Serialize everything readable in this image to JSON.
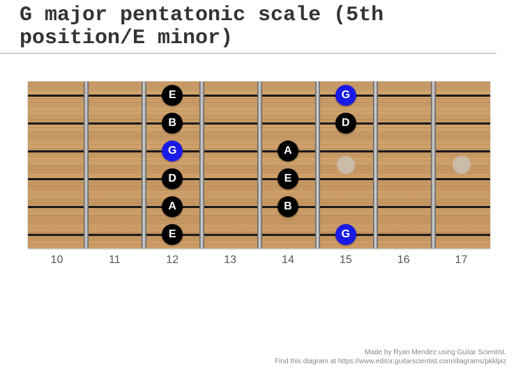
{
  "title": "G major pentatonic scale (5th position/E minor)",
  "credit": {
    "line1": "Made by Ryan Mendez using Guitar Scientist.",
    "line2": "Find this diagram at https://www.editor.guitarscientist.com/diagrams/pkklpiz"
  },
  "fretboard": {
    "strings": 6,
    "fret_start": 10,
    "fret_end": 17,
    "fret_markers_single": [
      15,
      17
    ],
    "fret_markers_double": [],
    "labeled_frets": [
      10,
      11,
      12,
      13,
      14,
      15,
      16,
      17
    ]
  },
  "notes": [
    {
      "string": 1,
      "fret": 12,
      "label": "E",
      "root": false
    },
    {
      "string": 1,
      "fret": 15,
      "label": "G",
      "root": true
    },
    {
      "string": 2,
      "fret": 12,
      "label": "B",
      "root": false
    },
    {
      "string": 2,
      "fret": 15,
      "label": "D",
      "root": false
    },
    {
      "string": 3,
      "fret": 12,
      "label": "G",
      "root": true
    },
    {
      "string": 3,
      "fret": 14,
      "label": "A",
      "root": false
    },
    {
      "string": 4,
      "fret": 12,
      "label": "D",
      "root": false
    },
    {
      "string": 4,
      "fret": 14,
      "label": "E",
      "root": false
    },
    {
      "string": 5,
      "fret": 12,
      "label": "A",
      "root": false
    },
    {
      "string": 5,
      "fret": 14,
      "label": "B",
      "root": false
    },
    {
      "string": 6,
      "fret": 12,
      "label": "E",
      "root": false
    },
    {
      "string": 6,
      "fret": 15,
      "label": "G",
      "root": true
    }
  ],
  "chart_data": {
    "type": "diagram",
    "title": "G major pentatonic scale (5th position/E minor)",
    "strings": 6,
    "fret_range": [
      10,
      17
    ],
    "root_note": "G",
    "scale_notes": [
      "G",
      "A",
      "B",
      "D",
      "E"
    ],
    "positions": [
      {
        "string": 1,
        "fret": 12,
        "note": "E"
      },
      {
        "string": 1,
        "fret": 15,
        "note": "G"
      },
      {
        "string": 2,
        "fret": 12,
        "note": "B"
      },
      {
        "string": 2,
        "fret": 15,
        "note": "D"
      },
      {
        "string": 3,
        "fret": 12,
        "note": "G"
      },
      {
        "string": 3,
        "fret": 14,
        "note": "A"
      },
      {
        "string": 4,
        "fret": 12,
        "note": "D"
      },
      {
        "string": 4,
        "fret": 14,
        "note": "E"
      },
      {
        "string": 5,
        "fret": 12,
        "note": "A"
      },
      {
        "string": 5,
        "fret": 14,
        "note": "B"
      },
      {
        "string": 6,
        "fret": 12,
        "note": "E"
      },
      {
        "string": 6,
        "fret": 15,
        "note": "G"
      }
    ]
  }
}
